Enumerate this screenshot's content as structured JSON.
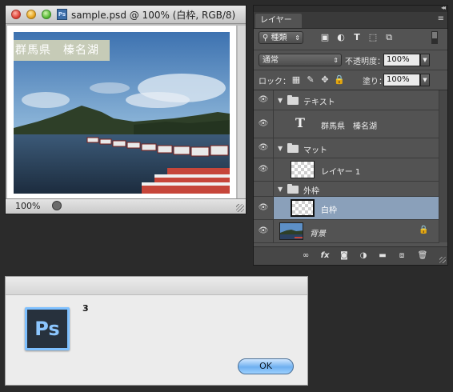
{
  "document_window": {
    "title": "sample.psd @ 100% (白枠, RGB/8)",
    "psd_icon_label": "Ps",
    "caption_text": "群馬県　榛名湖",
    "zoom": "100%"
  },
  "layers_panel": {
    "tab_label": "レイヤー",
    "tab_close": "«",
    "panel_menu": "≡",
    "kind_filter": "種類",
    "blend_mode": "通常",
    "opacity_label": "不透明度：",
    "opacity_value": "100%",
    "lock_label": "ロック：",
    "fill_label": "塗り：",
    "fill_value": "100%",
    "layers": [
      {
        "name": "テキスト",
        "type": "group"
      },
      {
        "name": "群馬県　榛名湖",
        "type": "text"
      },
      {
        "name": "マット",
        "type": "group"
      },
      {
        "name": "レイヤー 1",
        "type": "pixel"
      },
      {
        "name": "外枠",
        "type": "group"
      },
      {
        "name": "白枠",
        "type": "pixel",
        "selected": true
      },
      {
        "name": "背景",
        "type": "background",
        "locked": true
      }
    ]
  },
  "dialog": {
    "app_icon": "Ps",
    "message": "3",
    "ok_label": "OK"
  },
  "colors": {
    "selected_layer": "#8aa0ba",
    "panel_bg": "#535353",
    "ok_button": "#6fb0f0"
  }
}
